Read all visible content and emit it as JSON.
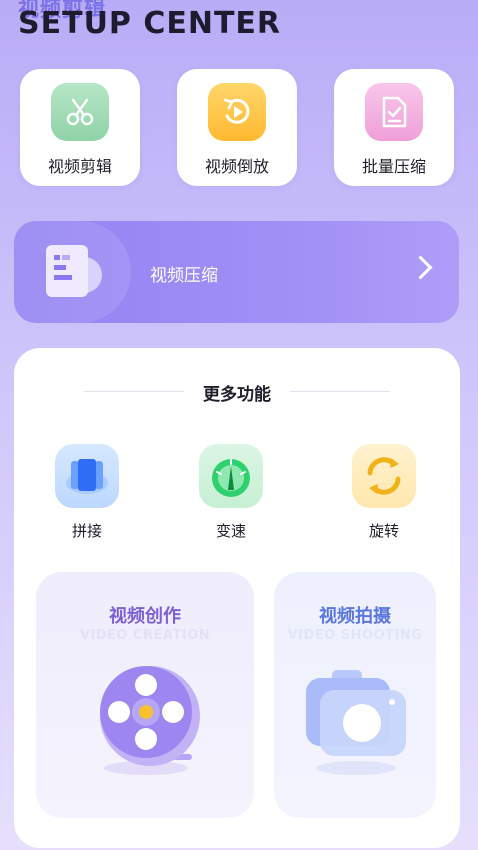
{
  "header": {
    "title_cn": "视频剪辑",
    "title_en": "SETUP CENTER"
  },
  "tools": [
    {
      "label": "视频剪辑",
      "icon": "scissors-icon"
    },
    {
      "label": "视频倒放",
      "icon": "reverse-play-icon"
    },
    {
      "label": "批量压缩",
      "icon": "batch-compress-icon"
    }
  ],
  "compress_banner": {
    "label": "视频压缩",
    "icon": "video-compress-icon",
    "arrow_icon": "chevron-right-icon"
  },
  "more": {
    "title": "更多功能",
    "features": [
      {
        "label": "拼接",
        "icon": "splice-icon"
      },
      {
        "label": "变速",
        "icon": "speedometer-icon"
      },
      {
        "label": "旋转",
        "icon": "rotate-icon"
      }
    ],
    "cards": [
      {
        "title": "视频创作",
        "subtitle": "VIDEO CREATION",
        "icon": "film-reel-icon"
      },
      {
        "title": "视频拍摄",
        "subtitle": "VIDEO SHOOTING",
        "icon": "camera-icon"
      }
    ]
  },
  "colors": {
    "background_top": "#b9acf7",
    "accent_purple": "#8a79f2",
    "creation_title": "#7d5fd9",
    "shooting_title": "#5b76e0"
  }
}
